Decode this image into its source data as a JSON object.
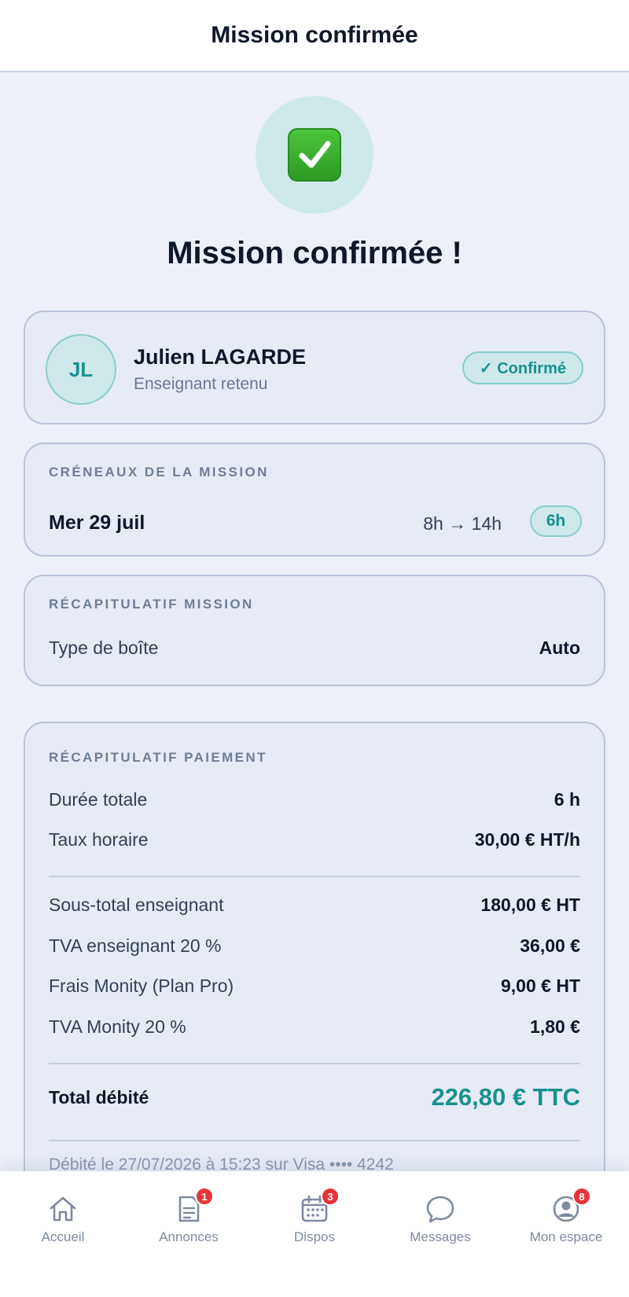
{
  "header": {
    "title": "Mission confirmée"
  },
  "hero": {
    "icon": "check-mark-button-icon",
    "title": "Mission confirmée !"
  },
  "teacher": {
    "initials": "JL",
    "name": "Julien LAGARDE",
    "role": "Enseignant retenu",
    "status": "✓ Confirmé"
  },
  "slots": {
    "label": "CRÉNEAUX DE LA MISSION",
    "date": "Mer 29 juil",
    "time": "8h → 14h",
    "duration": "6h"
  },
  "mission_summary": {
    "label": "RÉCAPITULATIF MISSION",
    "rows": [
      {
        "label": "Type de boîte",
        "value": "Auto"
      }
    ]
  },
  "payment_summary": {
    "label": "RÉCAPITULATIF PAIEMENT",
    "rows_a": [
      {
        "label": "Durée totale",
        "value": "6 h"
      },
      {
        "label": "Taux horaire",
        "value": "30,00 € HT/h"
      }
    ],
    "rows_b": [
      {
        "label": "Sous-total enseignant",
        "value": "180,00 € HT"
      },
      {
        "label": "TVA enseignant 20 %",
        "value": "36,00 €"
      },
      {
        "label": "Frais Monity (Plan Pro)",
        "value": "9,00 € HT"
      },
      {
        "label": "TVA Monity 20 %",
        "value": "1,80 €"
      }
    ],
    "total_label": "Total débité",
    "total_value": "226,80 € TTC",
    "debit_note": "Débité le 27/07/2026 à 15:23 sur Visa •••• 4242"
  },
  "nav": {
    "items": [
      {
        "label": "Accueil",
        "icon": "home-icon"
      },
      {
        "label": "Annonces",
        "icon": "document-icon",
        "badge": "1"
      },
      {
        "label": "Dispos",
        "icon": "calendar-icon",
        "badge": "3"
      },
      {
        "label": "Messages",
        "icon": "chat-bubble-icon"
      },
      {
        "label": "Mon espace",
        "icon": "user-icon",
        "badge": "8"
      }
    ]
  },
  "colors": {
    "accent": "#17918f",
    "badge": "#e5353a",
    "background": "#edf0f8"
  }
}
